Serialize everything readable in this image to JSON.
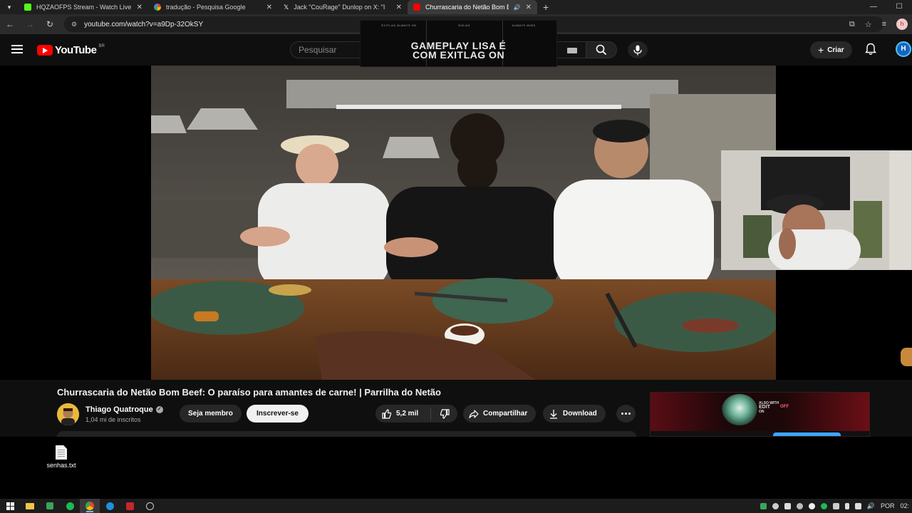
{
  "browser": {
    "tabs": [
      {
        "title": "HQZAOFPS Stream - Watch Live",
        "favicon_color": "#53fc18",
        "favicon": "kick-icon",
        "active": false
      },
      {
        "title": "tradução - Pesquisa Google",
        "favicon_color": "#4285f4",
        "favicon": "google-icon",
        "active": false
      },
      {
        "title": "Jack \"CouRage\" Dunlop on X: \"I",
        "favicon_color": "#ffffff",
        "favicon": "x-icon",
        "active": false
      },
      {
        "title": "Churrascaria do Netão Bom B",
        "favicon_color": "#ff0000",
        "favicon": "youtube-icon",
        "active": true
      }
    ],
    "url": "youtube.com/watch?v=a9Dp-32OkSY",
    "profile_initial": "h"
  },
  "youtube": {
    "logo_text": "YouTube",
    "region": "BR",
    "search_placeholder": "Pesquisar",
    "create_label": "Criar",
    "avatar_initial": "H"
  },
  "ad_overlay": {
    "top_labels": [
      "EXITLAG ALWAYS ON",
      "NOLAG",
      "ALWAYS WINS"
    ],
    "headline_line1": "GAMEPLAY LISA É",
    "headline_line2": "COM EXITLAG ON"
  },
  "video": {
    "title": "Churrascaria do Netão Bom Beef: O paraíso para amantes de carne! | Parrilha do Netão",
    "channel_name": "Thiago Quatroque",
    "subscribers": "1,04 mi de inscritos",
    "join_label": "Seja membro",
    "subscribe_label": "Inscrever-se",
    "likes": "5,2 mil",
    "share_label": "Compartilhar",
    "download_label": "Download"
  },
  "side_ad": {
    "line1": "ALSO WITH",
    "line2": "EDIT",
    "line3": "ON",
    "offer": "OFF"
  },
  "desktop": {
    "icon_label": "senhas.txt"
  },
  "taskbar": {
    "language": "POR",
    "clock": "02:"
  },
  "colors": {
    "youtube_red": "#ff0000",
    "yt_bg": "#0f0f0f",
    "chip_bg": "#272727",
    "subscribe_bg": "#f1f1f1"
  }
}
